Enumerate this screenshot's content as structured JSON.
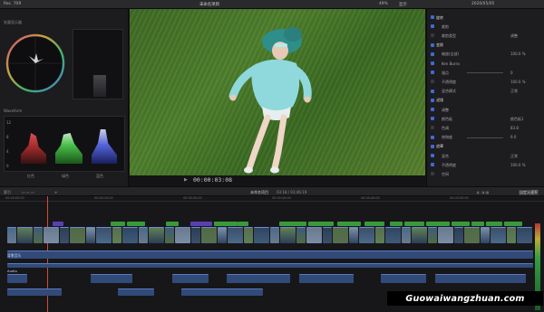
{
  "window": {
    "left_label": "Rec. 709",
    "project_title": "未命名项目",
    "zoom": "49%",
    "view_menu": "显示",
    "date": "2020/05/05"
  },
  "viewer": {
    "timecode": "00:00:03:08"
  },
  "scopes": {
    "vectorscope_label": "矢量显示器",
    "waveform_label": "Waveform",
    "tick_labels": [
      "12",
      "8",
      "4",
      "0"
    ],
    "bottom_labels": [
      "红色",
      "绿色",
      "蓝色"
    ]
  },
  "inspector": {
    "rows": [
      {
        "label": "旋转",
        "value": ""
      },
      {
        "label": "裁剪",
        "value": ""
      },
      {
        "label": "裁剪类型",
        "value": "调整"
      },
      {
        "label": "变换",
        "value": ""
      },
      {
        "label": "缩放(全部)",
        "value": "100.0 %"
      },
      {
        "label": "Ken Burns",
        "value": ""
      },
      {
        "label": "锚点",
        "value": "0"
      },
      {
        "label": "不透明度",
        "value": "100.0 %"
      },
      {
        "label": "混合模式",
        "value": "正常"
      },
      {
        "label": "滤镜",
        "value": ""
      },
      {
        "label": "调整",
        "value": ""
      },
      {
        "label": "颜色板",
        "value": "颜色板1"
      },
      {
        "label": "色调",
        "value": "83.8"
      },
      {
        "label": "饱和度",
        "value": "9.0"
      },
      {
        "label": "遮罩",
        "value": ""
      },
      {
        "label": "混合",
        "value": "正常"
      },
      {
        "label": "不透明度",
        "value": "100.0 %"
      },
      {
        "label": "空间",
        "value": ""
      }
    ]
  },
  "timeline": {
    "index_label": "索引",
    "project_name": "未命名项目",
    "duration": "03:18 / 03:46:19",
    "ruler": [
      "00:00:00:00",
      "00:00:10:00",
      "00:00:20:00",
      "00:00:30:00",
      "00:00:40:00",
      "00:00:50:00"
    ],
    "audio_label": "背景音乐",
    "audio_track_2": "Audio",
    "corner_button": "自定义速率"
  },
  "watermark": "Guowaiwangzhuan.com"
}
